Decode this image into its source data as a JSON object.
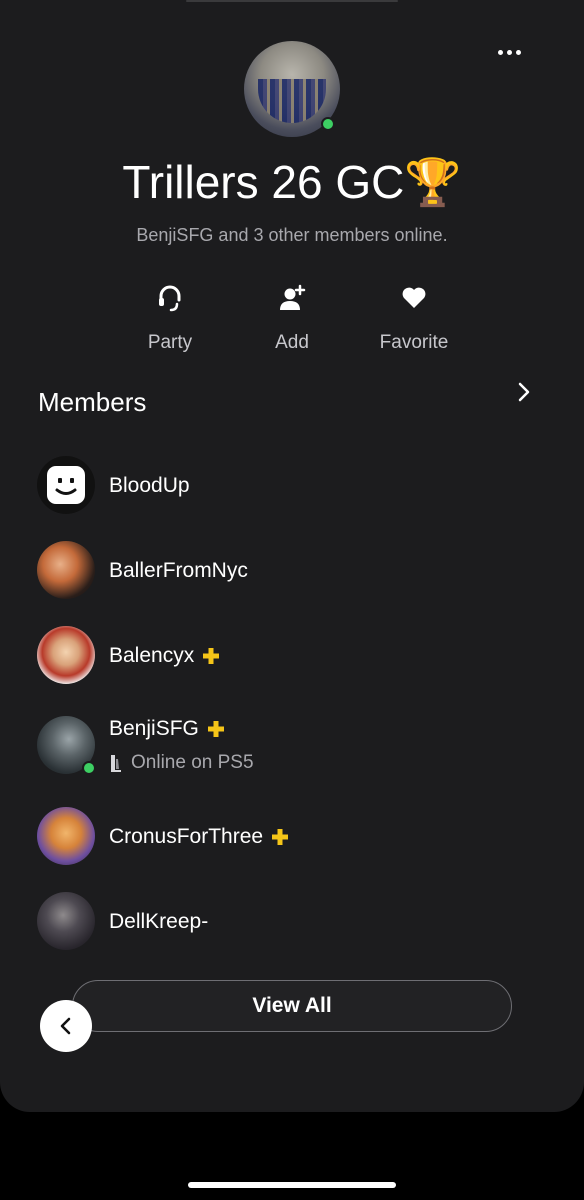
{
  "group": {
    "title": "Trillers 26 GC🏆",
    "subtitle": "BenjiSFG and 3 other members online."
  },
  "actions": [
    {
      "label": "Party",
      "icon": "headset-icon"
    },
    {
      "label": "Add",
      "icon": "add-person-icon"
    },
    {
      "label": "Favorite",
      "icon": "heart-icon"
    }
  ],
  "members_section": {
    "heading": "Members",
    "items": [
      {
        "name": "BloodUp",
        "plus": false,
        "online": false,
        "status": ""
      },
      {
        "name": "BallerFromNyc",
        "plus": false,
        "online": false,
        "status": ""
      },
      {
        "name": "Balencyx",
        "plus": true,
        "online": false,
        "status": ""
      },
      {
        "name": "BenjiSFG",
        "plus": true,
        "online": true,
        "status": "Online on PS5"
      },
      {
        "name": "CronusForThree",
        "plus": true,
        "online": false,
        "status": ""
      },
      {
        "name": "DellKreep-",
        "plus": false,
        "online": false,
        "status": ""
      }
    ]
  },
  "footer": {
    "view_all_label": "View All"
  },
  "colors": {
    "background": "#1c1c1e",
    "online": "#3dcf63",
    "plus": "#f5c518",
    "muted_text": "#a8a8ad"
  }
}
